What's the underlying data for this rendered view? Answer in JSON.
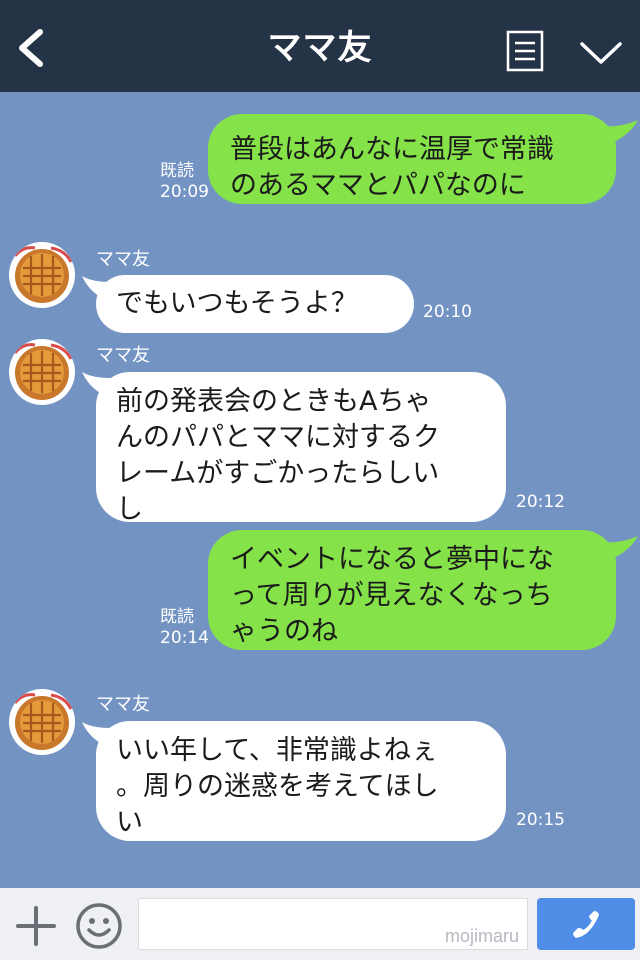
{
  "header": {
    "title": "ママ友"
  },
  "messages": [
    {
      "side": "right",
      "lines": [
        "普段はあんなに温厚で常識",
        "のあるママとパパなのに"
      ],
      "read": "既読",
      "time": "20:09"
    },
    {
      "side": "left",
      "sender": "ママ友",
      "lines": [
        "でもいつもそうよ？"
      ],
      "time": "20:10"
    },
    {
      "side": "left",
      "sender": "ママ友",
      "lines": [
        "前の発表会のときもAちゃ",
        "んのパパとママに対するク",
        "レームがすごかったらしい",
        "し"
      ],
      "time": "20:12"
    },
    {
      "side": "right",
      "lines": [
        "イベントになると夢中にな",
        "って周りが見えなくなっち",
        "ゃうのね"
      ],
      "read": "既読",
      "time": "20:14"
    },
    {
      "side": "left",
      "sender": "ママ友",
      "lines": [
        "いい年して、非常識よねぇ",
        "。周りの迷惑を考えてほし",
        "い"
      ],
      "time": "20:15"
    }
  ],
  "footer": {
    "watermark": "mojimaru"
  },
  "colors": {
    "header_bg": "#253347",
    "chat_bg": "#7394c3",
    "sent_bubble": "#85e249",
    "received_bubble": "#ffffff",
    "send_button": "#4f8de6"
  },
  "icons": [
    "back-chevron-icon",
    "menu-list-icon",
    "chevron-down-icon",
    "plus-icon",
    "smiley-icon",
    "phone-icon"
  ]
}
